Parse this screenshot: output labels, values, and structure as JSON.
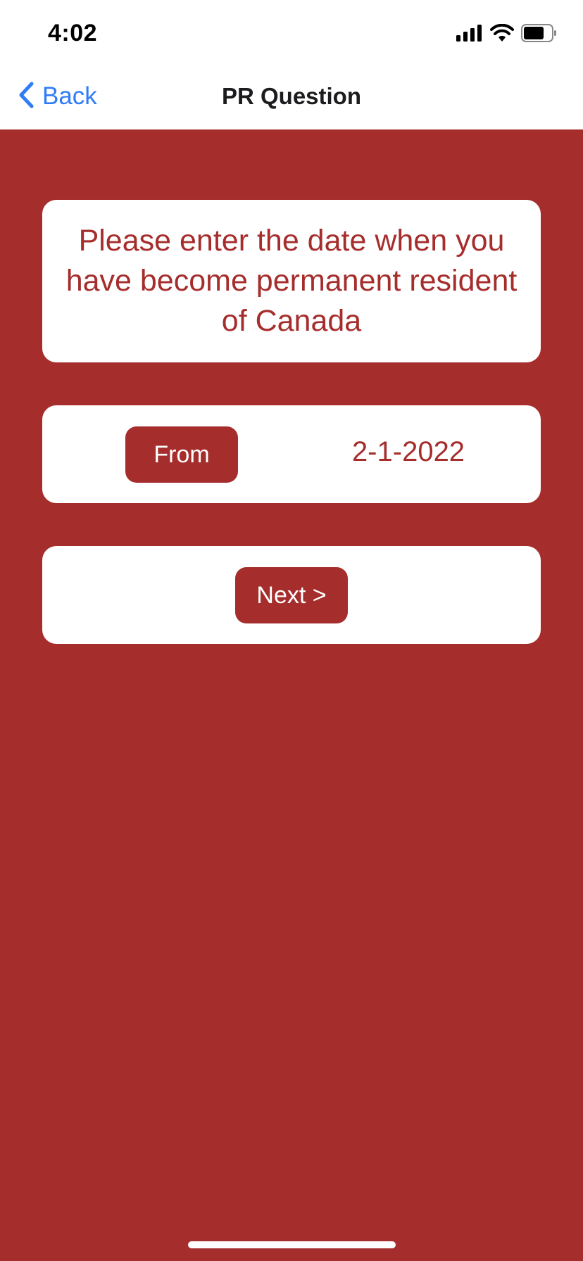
{
  "status_bar": {
    "time": "4:02",
    "icons": [
      "cellular-signal-icon",
      "wifi-icon",
      "battery-icon"
    ]
  },
  "nav": {
    "back_label": "Back",
    "title": "PR Question",
    "back_icon": "chevron-left-icon"
  },
  "question": {
    "text": "Please enter the date when you have become permanent resident of Canada"
  },
  "date_entry": {
    "button_label": "From",
    "value": "2-1-2022"
  },
  "next": {
    "button_label": "Next >"
  },
  "colors": {
    "background": "#a52e2d",
    "card": "#ffffff",
    "accent_text": "#a52e2d",
    "link_blue": "#2f7cf6"
  }
}
